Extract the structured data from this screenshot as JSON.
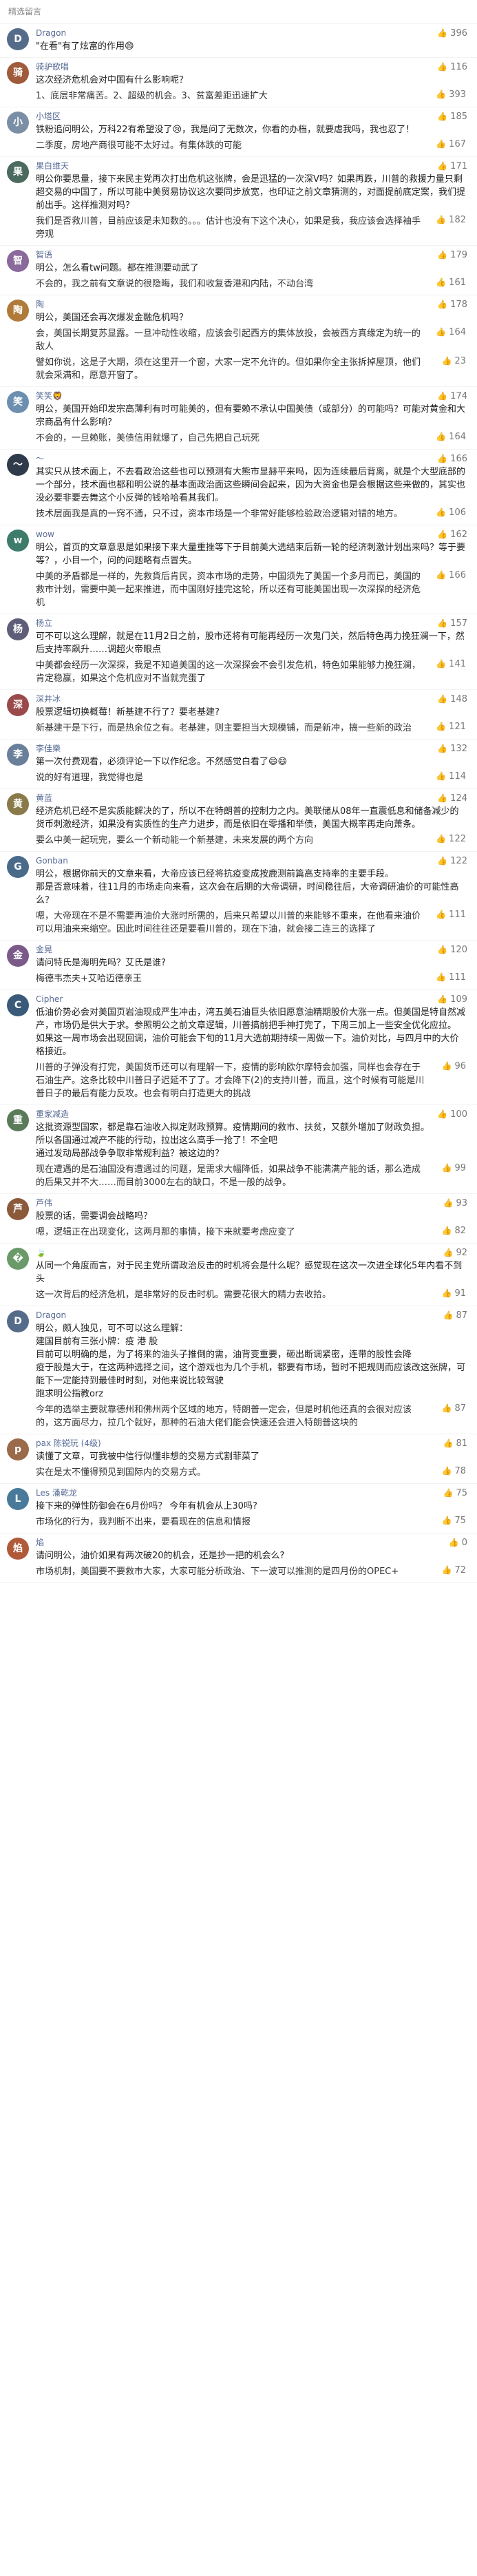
{
  "header": {
    "title": "精选留言"
  },
  "comments": [
    {
      "user": "Dragon",
      "avatar_color": "#556b8a",
      "likes": "396",
      "text": "\"在看\"有了炫富的作用😄",
      "replies": []
    },
    {
      "user": "骑驴歌唱",
      "avatar_color": "#a05a3c",
      "likes": "116",
      "text": "这次经济危机会对中国有什么影响呢？",
      "replies": [
        {
          "text": "1、底层非常痛苦。2、超级的机会。3、贫富差距迅速扩大",
          "likes": "393"
        }
      ]
    },
    {
      "user": "小塔区",
      "avatar_color": "#7a8fa6",
      "likes": "185",
      "text": "铁粉追问明公，万科22有希望没了😢，我是问了无数次，你看的办档，就要虐我吗，我也忍了！",
      "replies": [
        {
          "text": "二季度，房地产商很可能不太好过。有集体跌的可能",
          "likes": "167"
        }
      ]
    },
    {
      "user": "果白维天",
      "avatar_color": "#4b6b5e",
      "likes": "171",
      "text": "明公你要思量，接下来民主党再次打出危机这张牌，会是迅猛的一次深V吗？如果再跌，川普的救援力量只剩超交易的中国了，所以可能中美贸易协议这次要同步放宽，也印证之前文章猜测的，对面提前底定案，我们提前出手。这样推测对吗？",
      "replies": [
        {
          "text": "我们是否救川普，目前应该是未知数的。。。估计也没有下这个决心，如果是我，我应该会选择袖手旁观",
          "likes": "182"
        }
      ]
    },
    {
      "user": "智语",
      "avatar_color": "#8a6a9a",
      "likes": "179",
      "text": "明公，怎么看tw问题。都在推测要动武了",
      "replies": [
        {
          "text": "不会的，我之前有文章说的很隐晦，我们和收复香港和内陆，不动台湾",
          "likes": "161"
        }
      ]
    },
    {
      "user": "陶",
      "avatar_color": "#b07b3a",
      "likes": "178",
      "text": "明公，美国还会再次爆发金融危机吗？",
      "replies": [
        {
          "text": "会，美国长期复苏显露。一旦冲动性收缩，应该会引起西方的集体放投，会被西方真缘定为统一的敌人",
          "likes": "164"
        },
        {
          "text": "譬如你说，这是子大期，须在这里开一个窗，大家一定不允许的。但如果你全主张拆掉屋顶，他们就会采满和，愿意开窗了。",
          "likes": "23"
        }
      ]
    },
    {
      "user": "笑笑🦁",
      "avatar_color": "#6c8fb0",
      "likes": "174",
      "text": "明公，美国开始印发宗高薄利有时可能美的，但有要赖不承认中国美债（或部分）的可能吗？可能对黄金和大宗商品有什么影响？",
      "replies": [
        {
          "text": "不会的，一旦赖账，美债信用就爆了，自己先把自己玩死",
          "likes": "164"
        }
      ]
    },
    {
      "user": "～",
      "avatar_color": "#2f3b4a",
      "likes": "166",
      "text": "其实只从技术面上，不去看政治这些也可以预测有大熊市显赫平来吗，因为连续最后背离，就是个大型底部的一个部分，技术面也都和明公说的基本面政治面这些瞬间会起来，因为大资金也是会根据这些来做的，其实也没必要非要去舞这个小反弹的钱哈哈看其我们。",
      "replies": [
        {
          "text": "技术层面我是真的一窍不通，只不过，资本市场是一个非常好能够检验政治逻辑对错的地方。",
          "likes": "106"
        }
      ]
    },
    {
      "user": "wow",
      "avatar_color": "#3d7b6a",
      "likes": "162",
      "text": "明公，首页的文章意思是如果接下来大量重挫等下于目前美大选结束后新一轮的经济刺激计划出来吗？等于要等？，小目一个，问的问题略有点冒失。",
      "replies": [
        {
          "text": "中美的矛盾都是一样的，先救貨后肯民，资本市场的走势，中国须先了美国一个多月而已，美国的救市计划，需要中美一起来推进，而中国刚好挂完这轮，所以还有可能美国出现一次深探的经济危机",
          "likes": "166"
        }
      ]
    },
    {
      "user": "杨立",
      "avatar_color": "#5e5e78",
      "likes": "157",
      "text": "可不可以这么理解，就是在11月2日之前，股市还将有可能再经历一次鬼门关，然后特色再力挽狂澜一下，然后支持率飙升……调超火帝眼点",
      "replies": [
        {
          "text": "中美都会经历一次深探，我是不知道美国的这一次深探会不会引发危机，特色如果能够力挽狂澜，肯定稳赢，如果这个危机应对不当就完蛋了",
          "likes": "141"
        }
      ]
    },
    {
      "user": "深井冰",
      "avatar_color": "#9a4a4a",
      "likes": "148",
      "text": "股票逻辑切换概莓！新基建不行了？要老基建?",
      "replies": [
        {
          "text": "新基建干是下行，而是热余位之有。老基建，则主要担当大规模铺，而是新冲，搞一些新的政治",
          "likes": "121"
        }
      ]
    },
    {
      "user": "李佳樂",
      "avatar_color": "#6a7f9a",
      "likes": "132",
      "text": "第一次付费观看，必须评论一下以作纪念。不然感觉白看了😄😄",
      "replies": [
        {
          "text": "说的好有道理，我觉得也是",
          "likes": "114"
        }
      ]
    },
    {
      "user": "黄蓝",
      "avatar_color": "#8a7a4a",
      "likes": "124",
      "text": "经济危机已经不是实质能解决的了，所以不在特朗普的控制力之内。美联储从08年一直震低息和储备减少的货币刺激经济，如果没有实质性的生产力进步，而是依旧在零播和举债，美国大概率再走向萧条。",
      "replies": [
        {
          "text": "要么中美一起玩完，要么一个新动能一个新基建，未来发展的两个方向",
          "likes": "122"
        }
      ]
    },
    {
      "user": "Gonban",
      "avatar_color": "#4a6a8a",
      "likes": "122",
      "text": "明公，根据你前天的文章来看，大帝应该已经将抗疫变成按鹿测前篇高支持率的主要手段。\n那是否意味着，往11月的市场走向来看，这次会在后期的大帝调研，时间稳往后，大帝调研油价的可能性高么？",
      "replies": [
        {
          "text": "嗯，大帝现在不是不需要再油价大涨时所需的，后来只希望以川普的来能够不重来，在他看来油价可以用油来来缩空。因此时间往往还是要看川普的，现在下油，就会接二连三的选择了",
          "likes": "111"
        }
      ]
    },
    {
      "user": "金晃",
      "avatar_color": "#7b5a8a",
      "likes": "120",
      "text": "请问特氏是海明先吗？艾氏是谁?",
      "replies": [
        {
          "text": "梅德韦杰夫+艾哈迈德亲王",
          "likes": "111"
        }
      ]
    },
    {
      "user": "Cipher",
      "avatar_color": "#3a5a7a",
      "likes": "109",
      "text": "低油价势必会对美国页岩油现成严生冲击，湾五美石油巨头依旧愿意油精期股价大涨一点。但美国是特自然减产，市场仍是供大于求。参照明公之前文章逻辑，川普搞前把手神打完了，下周三加上一些安全优化应拉。\n如果这一周市场会出现回调，油价可能会下旬的11月大选前期持续一周做一下。油价对比，与四月中的大价格接近。",
      "replies": [
        {
          "text": "川普的子弹没有打完，美国货币还可以有理解一下，疫情的影响欧尔摩特会加强，同样也会存在于石油生产。这条比较中川普日子迟延不了了。才会降下(2)的支持川普，而且，这个时候有可能是川普日子的最后有能力反攻。也会有明白打造更大的挑战",
          "likes": "96"
        }
      ]
    },
    {
      "user": "重家减造",
      "avatar_color": "#5a7a5a",
      "likes": "100",
      "text": "这批资源型国家，都是靠石油收入拟定财政预算。疫情期间的救市、扶贫，又额外增加了财政负担。\n所以各国通过减产不能的行动，拉出这么高手一抢了！不全吧\n通过发动局部战争争取非常规利益？被这边的？",
      "replies": [
        {
          "text": "现在遭遇的是石油国没有遭遇过的问题，是需求大幅降低，如果战争不能满满产能的话，那么造成的后果又并不大……而目前3000左右的缺口，不是一般的战争。",
          "likes": "99"
        }
      ]
    },
    {
      "user": "芦伟",
      "avatar_color": "#8a5a3a",
      "likes": "93",
      "text": "股票的话，需要调会战略吗？",
      "replies": [
        {
          "text": "嗯，逻辑正在出现变化，这两月那的事情，接下来就要考虑应变了",
          "likes": "82"
        }
      ]
    },
    {
      "user": "🍃",
      "avatar_color": "#6a9a6a",
      "likes": "92",
      "text": "从同一个角度而言，对于民主党所谓政治反击的时机将会是什么呢？感觉现在这次一次进全球化5年内看不到头",
      "replies": [
        {
          "text": "这一次背后的经济危机，是非常好的反击时机。需要花很大的精力去收拾。",
          "likes": "91"
        }
      ]
    },
    {
      "user": "Dragon",
      "avatar_color": "#556b8a",
      "likes": "87",
      "text": "明公，颇人独见，可不可以这么理解：\n建国目前有三张小牌：疫 港 股\n目前可以明确的是，为了将来的油头子推倒的需，油背变重要，砸出断调紧密，连带的股性会降\n疫于股是大于，在这两种选择之间，这个游戏也为几个手机，都要有市场，暂时不把规则而应该改这张牌，可能下一定能持到最佳时时刻，对他来说比较驾驶\n跑求明公指教orz",
      "replies": [
        {
          "text": "今年的选举主要就靠德州和佛州两个区域的地方，特朗普一定会，但是时机他还真的会很对应该的，这方面尽力，拉几个就好，那种的石油大佬们能会快速还会进入特朗普这块的",
          "likes": "87"
        }
      ]
    },
    {
      "user": "pax 陈锐玩 (4级)",
      "avatar_color": "#9a6a4a",
      "likes": "81",
      "text": "读懂了文章，可我被中信行似懂非想的交易方式割菲菜了",
      "replies": [
        {
          "text": "实在是太不懂得预见到国际内的交易方式。",
          "likes": "78"
        }
      ]
    },
    {
      "user": "Les 潘乾龙",
      "avatar_color": "#4a7a9a",
      "likes": "75",
      "text": "接下来的弹性防御会在6月份吗？ 今年有机会从上30吗?",
      "replies": [
        {
          "text": "市场化的行为，我判断不出来，要看现在的信息和情报",
          "likes": "75"
        }
      ]
    },
    {
      "user": "焰",
      "avatar_color": "#b05a3a",
      "likes": "0",
      "text": "请问明公，油价如果有两次破20的机会，还是抄一把的机会么?",
      "replies": [
        {
          "text": "市场机制，美国要不要救市大家，大家可能分析政治、下一波可以推测的是四月份的OPEC+",
          "likes": "72"
        }
      ]
    }
  ]
}
